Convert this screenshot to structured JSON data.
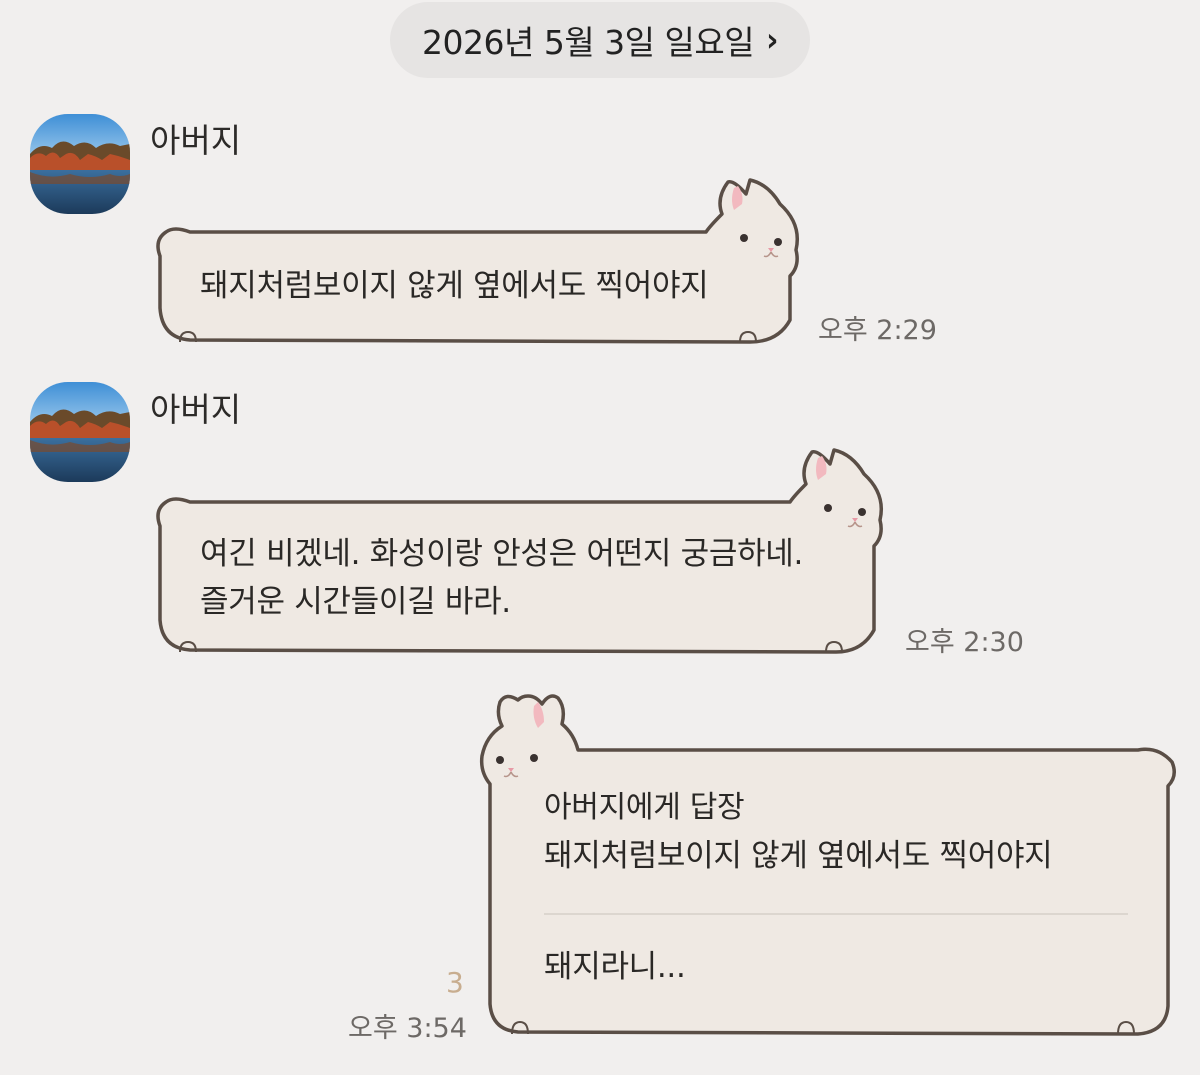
{
  "date_header": {
    "label": "2026년 5월 3일 일요일",
    "chevron_icon": "chevron-right-icon"
  },
  "messages": [
    {
      "sender": "아버지",
      "text": "돼지처럼보이지 않게 옆에서도  찍어야지",
      "time": "오후 2:29"
    },
    {
      "sender": "아버지",
      "text": "여긴 비겠네. 화성이랑 안성은 어떤지 궁금하네.\n즐거운  시간들이길 바라.",
      "time": "오후 2:30"
    }
  ],
  "my_message": {
    "reply_to_label": "아버지에게 답장",
    "quoted_text": "돼지처럼보이지 않게 옆에서도  찍어야지",
    "text": "돼지라니...",
    "unread_count": "3",
    "time": "오후 3:54"
  },
  "colors": {
    "background": "#f1efee",
    "bubble_fill": "#efe9e3",
    "bubble_outline": "#5a4e46",
    "bunny_ear": "#f2b9bf",
    "unread": "#c8ad8f"
  },
  "icons": [
    "avatar-landscape",
    "bunny-sticker-frame",
    "chevron-right-icon"
  ]
}
